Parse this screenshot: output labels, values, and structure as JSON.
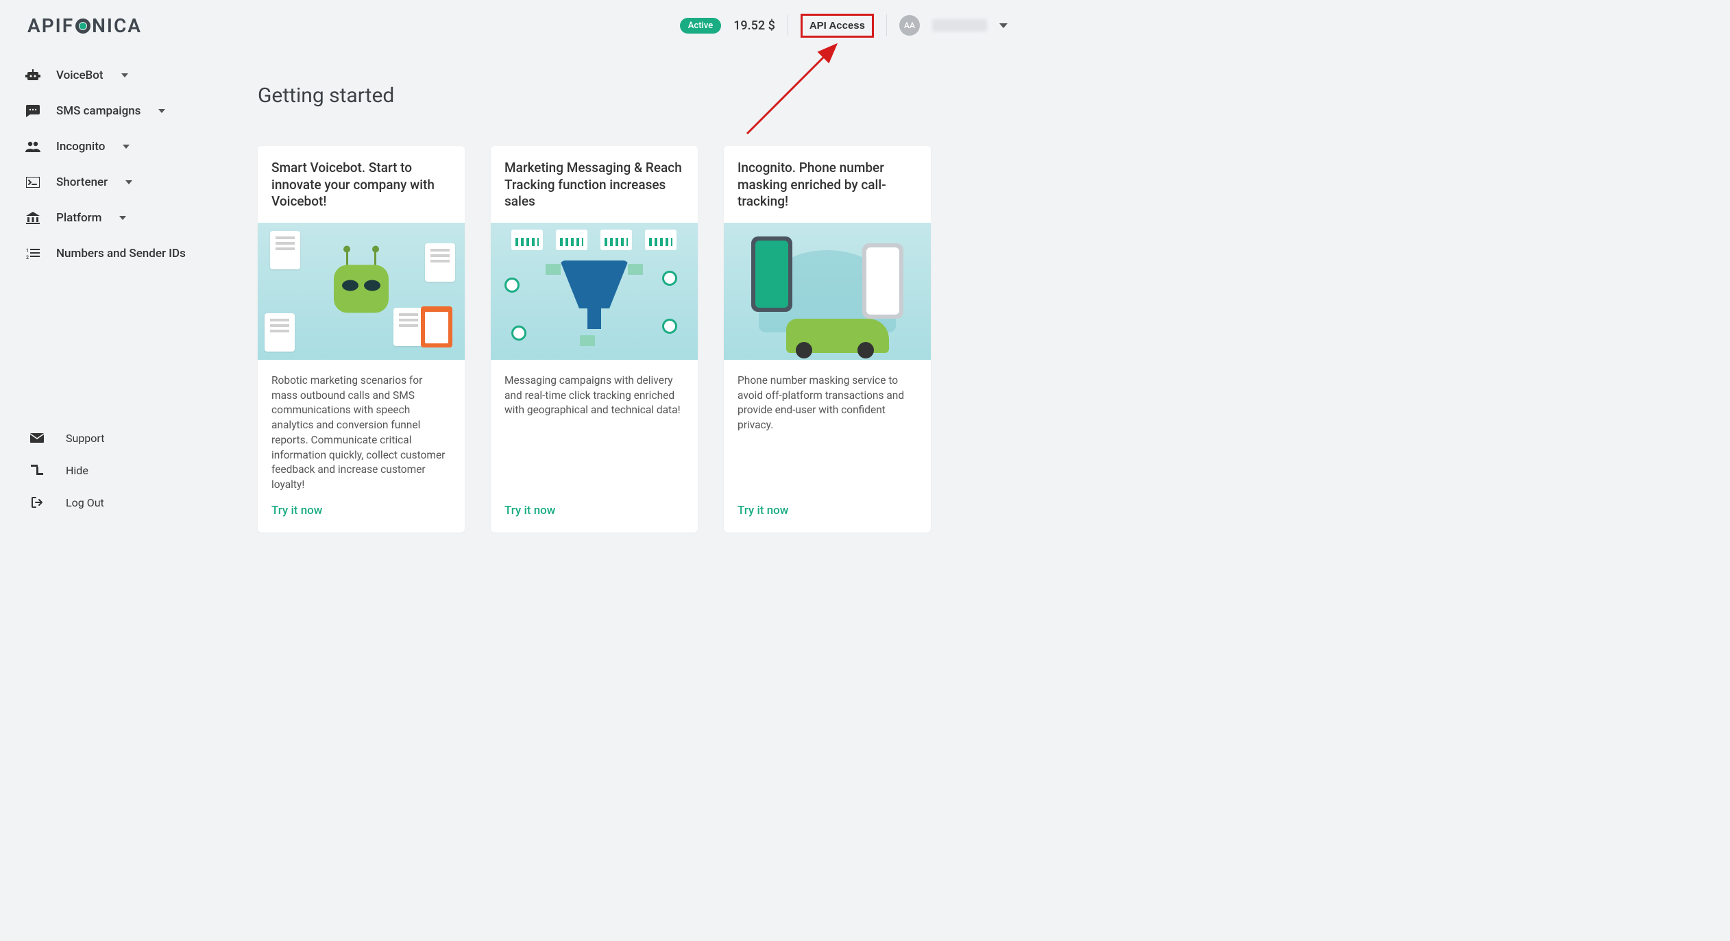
{
  "brand": "APIFONICA",
  "header": {
    "status_badge": "Active",
    "balance": "19.52 $",
    "api_access_label": "API Access",
    "avatar_initials": "AA"
  },
  "sidebar": {
    "items": [
      {
        "label": "VoiceBot",
        "has_chevron": true
      },
      {
        "label": "SMS campaigns",
        "has_chevron": true
      },
      {
        "label": "Incognito",
        "has_chevron": true
      },
      {
        "label": "Shortener",
        "has_chevron": true
      },
      {
        "label": "Platform",
        "has_chevron": true
      },
      {
        "label": "Numbers and Sender IDs",
        "has_chevron": false
      }
    ],
    "bottom": [
      {
        "label": "Support"
      },
      {
        "label": "Hide"
      },
      {
        "label": "Log Out"
      }
    ]
  },
  "main": {
    "title": "Getting started",
    "cards": [
      {
        "title": "Smart Voicebot. Start to innovate your company with Voicebot!",
        "desc": "Robotic marketing scenarios for mass outbound calls and SMS communications with speech analytics and conversion funnel reports. Communicate critical information quickly, collect customer feedback and increase customer loyalty!",
        "cta": "Try it now"
      },
      {
        "title": "Marketing Messaging & Reach Tracking function increases sales",
        "desc": "Messaging campaigns with delivery and real-time click tracking enriched with geographical and technical data!",
        "cta": "Try it now"
      },
      {
        "title": "Incognito. Phone number masking enriched by call-tracking!",
        "desc": "Phone number masking service to avoid off-platform transactions and provide end-user with confident privacy.",
        "cta": "Try it now"
      }
    ]
  }
}
